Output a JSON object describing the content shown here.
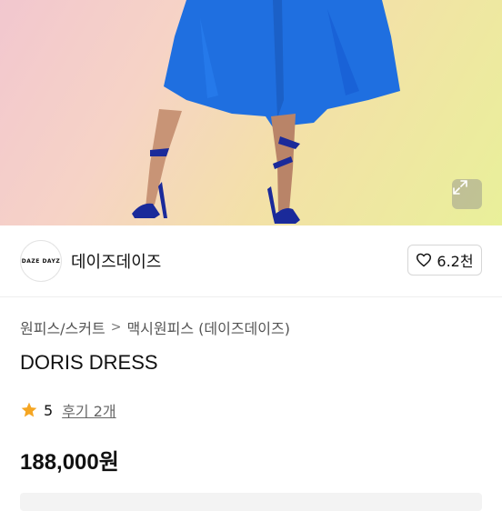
{
  "hero": {
    "image_alt": "DORIS DRESS photo",
    "expand_icon": "expand-icon"
  },
  "shop": {
    "logo_text": "DAZE DAYZ",
    "name": "데이즈데이즈",
    "like_icon": "heart-icon",
    "like_count": "6.2천"
  },
  "breadcrumb": {
    "items": [
      "원피스/스커트",
      "맥시원피스 (데이즈데이즈)"
    ],
    "separator": ">"
  },
  "product": {
    "title": "DORIS DRESS",
    "rating": "5",
    "reviews_label": "후기 2개",
    "price": "188,000원"
  },
  "colors": {
    "dress_blue": "#1f6fe0",
    "star": "#f5a623"
  }
}
